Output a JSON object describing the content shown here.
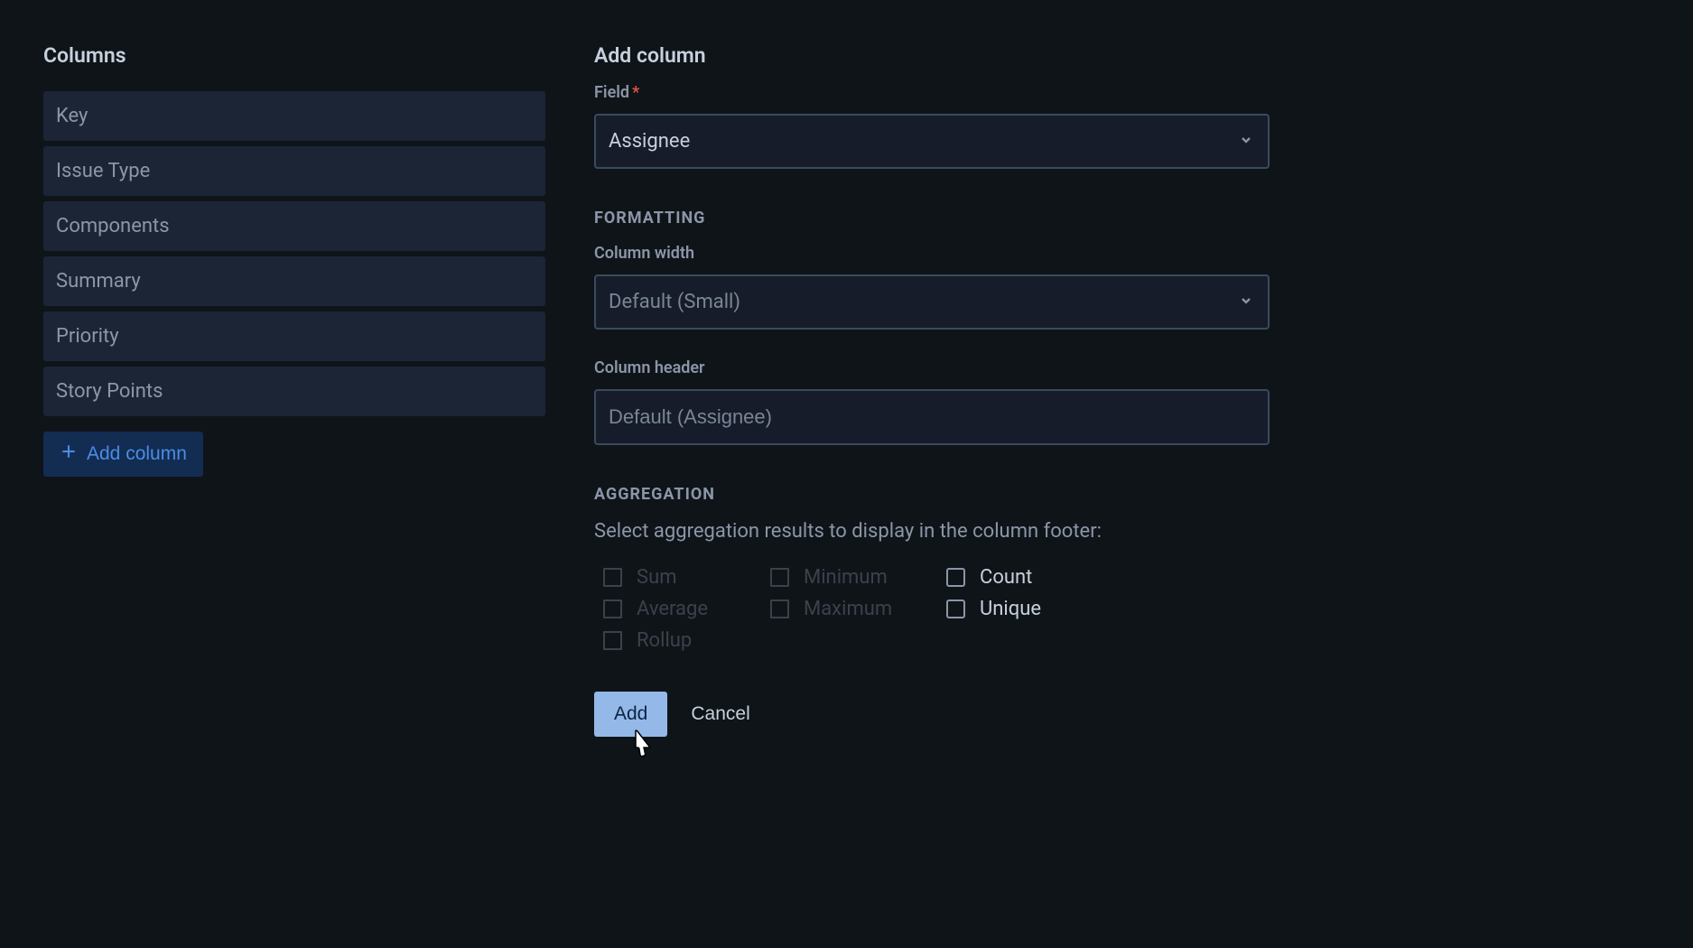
{
  "left": {
    "title": "Columns",
    "items": [
      "Key",
      "Issue Type",
      "Components",
      "Summary",
      "Priority",
      "Story Points"
    ],
    "add_column_label": "Add column"
  },
  "right": {
    "title": "Add column",
    "field_label": "Field",
    "field_value": "Assignee",
    "formatting_title": "FORMATTING",
    "column_width_label": "Column width",
    "column_width_value": "Default (Small)",
    "column_header_label": "Column header",
    "column_header_placeholder": "Default (Assignee)",
    "aggregation_title": "AGGREGATION",
    "aggregation_description": "Select aggregation results to display in the column footer:",
    "checks": {
      "sum": "Sum",
      "average": "Average",
      "rollup": "Rollup",
      "minimum": "Minimum",
      "maximum": "Maximum",
      "count": "Count",
      "unique": "Unique"
    },
    "add_button": "Add",
    "cancel_button": "Cancel"
  }
}
